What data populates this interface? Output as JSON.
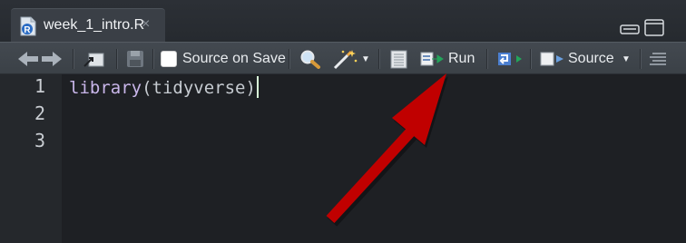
{
  "tab": {
    "file_icon_letter": "R",
    "label": "week_1_intro.R",
    "close_glyph": "×"
  },
  "toolbar": {
    "source_on_save_label": "Source on Save",
    "source_on_save_checked": false,
    "run_label": "Run",
    "source_label": "Source"
  },
  "editor": {
    "line_numbers": [
      "1",
      "2",
      "3"
    ],
    "code": {
      "fn": "library",
      "open": "(",
      "arg": "tidyverse",
      "close": ")"
    }
  },
  "annotation": {
    "arrow_color": "#c00000",
    "points_to": "run-button"
  },
  "colors": {
    "editor_bg": "#1e2024",
    "toolbar_bg": "#3b4147",
    "function_token": "#c9b6ea"
  }
}
